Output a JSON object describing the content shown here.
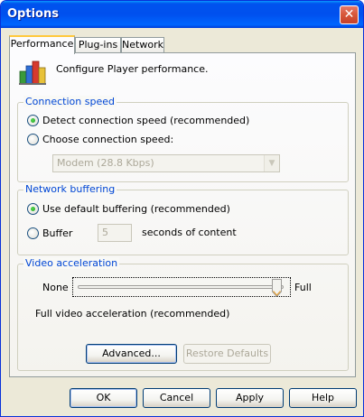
{
  "window": {
    "title": "Options",
    "close_glyph": "✕"
  },
  "tabs": [
    {
      "label": "Performance",
      "active": true
    },
    {
      "label": "Plug-ins",
      "active": false
    },
    {
      "label": "Network",
      "active": false
    }
  ],
  "header": {
    "icon": "performance-bars-icon",
    "text": "Configure Player performance."
  },
  "connection_speed": {
    "legend": "Connection speed",
    "detect_label": "Detect connection speed (recommended)",
    "detect_checked": true,
    "choose_label": "Choose connection speed:",
    "choose_checked": false,
    "dropdown_value": "Modem (28.8 Kbps)",
    "dropdown_arrow": "▼"
  },
  "network_buffering": {
    "legend": "Network buffering",
    "default_label": "Use default buffering (recommended)",
    "default_checked": true,
    "buffer_label": "Buffer",
    "buffer_checked": false,
    "buffer_value": "5",
    "buffer_suffix": "seconds of content"
  },
  "video_acceleration": {
    "legend": "Video acceleration",
    "min_label": "None",
    "max_label": "Full",
    "level": 1.0,
    "status_text": "Full video acceleration (recommended)",
    "advanced_label": "Advanced...",
    "restore_label": "Restore Defaults"
  },
  "footer": {
    "ok_label": "OK",
    "cancel_label": "Cancel",
    "apply_label": "Apply",
    "help_label": "Help"
  },
  "colors": {
    "accent": "#0046d5",
    "title_bar": "#0053ee",
    "dialog_bg": "#ece9d8"
  }
}
